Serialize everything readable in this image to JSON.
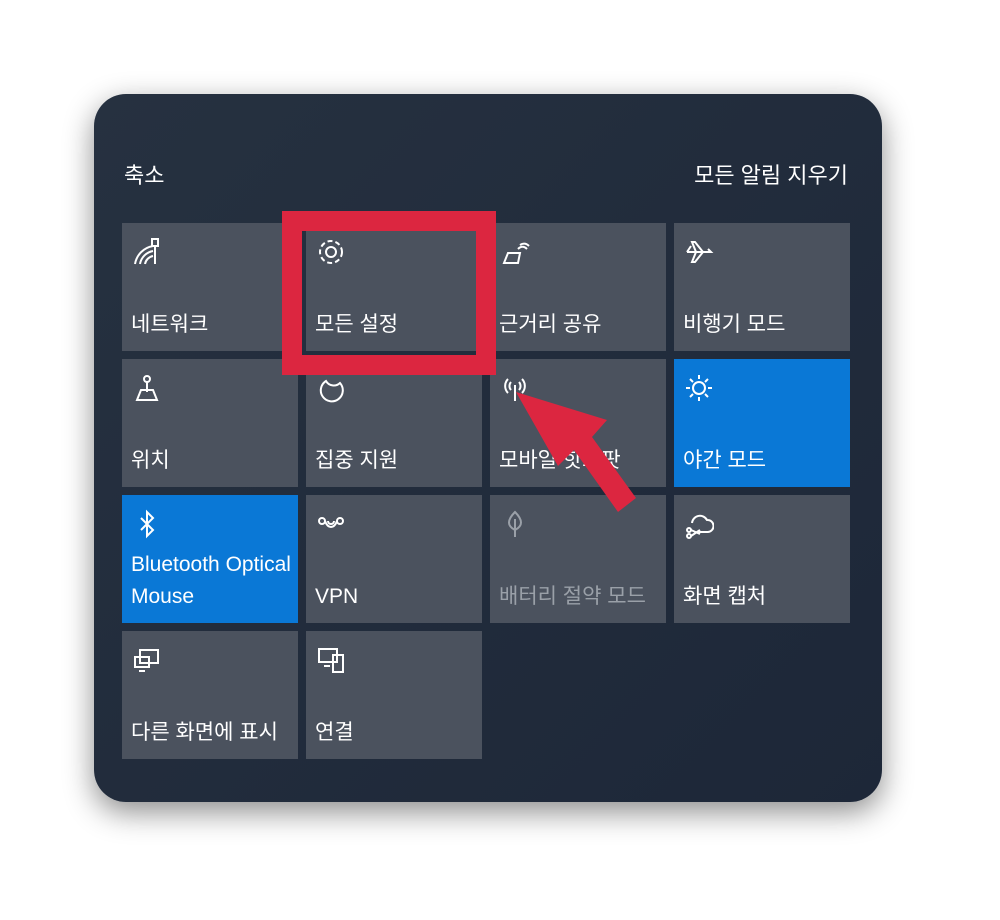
{
  "header": {
    "collapse_label": "축소",
    "clear_all_label": "모든 알림 지우기"
  },
  "tiles": [
    {
      "label": "네트워크",
      "icon": "network-icon",
      "state": "off"
    },
    {
      "label": "모든 설정",
      "icon": "gear-icon",
      "state": "off"
    },
    {
      "label": "근거리 공유",
      "icon": "nearby-share-icon",
      "state": "off"
    },
    {
      "label": "비행기 모드",
      "icon": "airplane-icon",
      "state": "off"
    },
    {
      "label": "위치",
      "icon": "location-icon",
      "state": "off"
    },
    {
      "label": "집중 지원",
      "icon": "moon-icon",
      "state": "off"
    },
    {
      "label": "모바일 핫스팟",
      "icon": "hotspot-icon",
      "state": "off"
    },
    {
      "label": "야간 모드",
      "icon": "night-light-icon",
      "state": "on"
    },
    {
      "label": "Bluetooth Optical Mouse",
      "icon": "bluetooth-icon",
      "state": "on"
    },
    {
      "label": "VPN",
      "icon": "vpn-icon",
      "state": "off"
    },
    {
      "label": "배터리 절약 모드",
      "icon": "leaf-icon",
      "state": "disabled"
    },
    {
      "label": "화면 캡처",
      "icon": "snip-icon",
      "state": "off"
    },
    {
      "label": "다른 화면에 표시",
      "icon": "project-icon",
      "state": "off"
    },
    {
      "label": "연결",
      "icon": "connect-icon",
      "state": "off"
    }
  ],
  "colors": {
    "accent": "#0a78d6",
    "tile": "#4b525e",
    "annotation": "#dc2640"
  }
}
